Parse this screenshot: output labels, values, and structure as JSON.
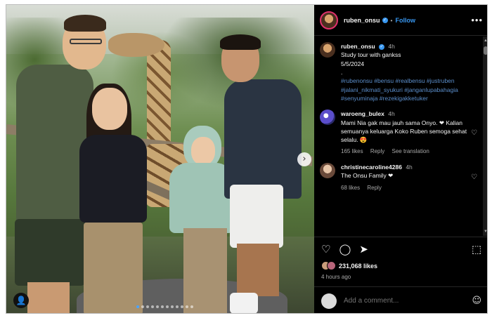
{
  "post": {
    "username": "ruben_onsu",
    "follow_label": "Follow",
    "more_label": "•••",
    "dot_separator": "•",
    "carousel_next": "›",
    "carousel_index": 1,
    "carousel_total": 12,
    "caption": {
      "username": "ruben_onsu",
      "time": "4h",
      "line1": "Study tour with gankss",
      "line2": "5/5/2024",
      "line3": ".",
      "hashtags": "#rubenonsu #bensu #realbensu #justruben #jalani_nikmati_syukuri #janganlupabahagia #senyuminaja #rezekigakketuker"
    },
    "comments": [
      {
        "username": "waroeng_bulex",
        "time": "4h",
        "text": "Mami Nia gak mau jauh sama Onyo. ❤ Kalian semuanya keluarga Koko Ruben semoga sehat selalu. 😍",
        "likes": "165 likes",
        "reply": "Reply",
        "translate": "See translation"
      },
      {
        "username": "christinecaroline4286",
        "time": "4h",
        "text": "The Onsu Family ❤",
        "likes": "68 likes",
        "reply": "Reply"
      }
    ],
    "likes_count": "231,068 likes",
    "time_ago": "4 hours ago",
    "comment_placeholder": "Add a comment..."
  }
}
